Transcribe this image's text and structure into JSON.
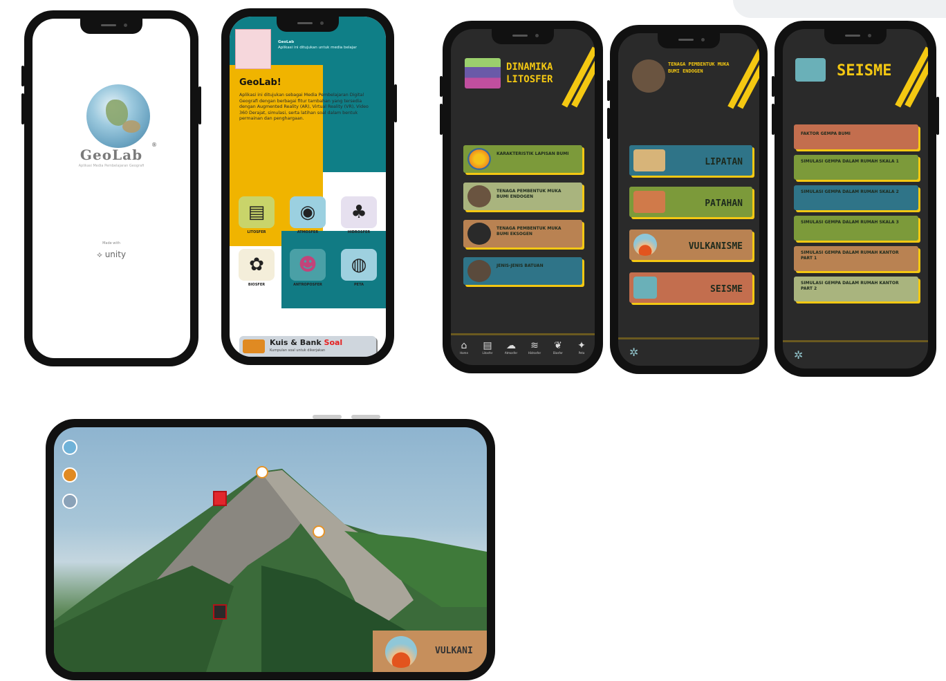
{
  "splash": {
    "brand": "GeoLab",
    "registered": "®",
    "tagline": "Aplikasi Media Pembelajaran Geografi",
    "made_with": "Made with",
    "engine": "unity"
  },
  "home": {
    "header_text": "GeoLab",
    "header_sub": "Aplikasi ini ditujukan untuk media belajar",
    "title": "GeoLab!",
    "description": "Aplikasi ini ditujukan sebagai Media Pembelajaran Digital Geografi dengan berbagai fitur tambahan yang tersedia dengan Augmented Reality (AR), Virtual Reality (VR), Video 360 Derajat, simulasi, serta latihan soal dalam bentuk permainan dan penghargaan.",
    "menu": [
      {
        "label": "LITOSFER",
        "icon": "layers-icon"
      },
      {
        "label": "ATMOSFER",
        "icon": "camera-icon"
      },
      {
        "label": "HIDROSFER",
        "icon": "tree-icon"
      },
      {
        "label": "BIOSFER",
        "icon": "flower-icon"
      },
      {
        "label": "ANTROPOSFER",
        "icon": "people-icon"
      },
      {
        "label": "PETA",
        "icon": "map-icon"
      }
    ],
    "quiz_title": "Kuis & Bank",
    "quiz_title_red": "Soal",
    "quiz_sub": "Kumpulan soal untuk dikerjakan"
  },
  "litosfer": {
    "title": "DINAMIKA LITOSFER",
    "items": [
      {
        "label": "KARAKTERISTIK LAPISAN BUMI",
        "color": "#7c9a3a"
      },
      {
        "label": "TENAGA PEMBENTUK MUKA BUMI ENDOGEN",
        "color": "#a9b47e"
      },
      {
        "label": "TENAGA PEMBENTUK MUKA BUMI EKSOGEN",
        "color": "#b98252"
      },
      {
        "label": "JENIS-JENIS BATUAN",
        "color": "#2f7488"
      }
    ],
    "nav": [
      "Home",
      "Litosfer",
      "Atmosfer",
      "Hidrosfer",
      "Biosfer",
      "Peta"
    ]
  },
  "endogen": {
    "title": "TENAGA PEMBENTUK MUKA BUMI ENDOGEN",
    "items": [
      {
        "label": "LIPATAN",
        "color": "#2f7488"
      },
      {
        "label": "PATAHAN",
        "color": "#7c9a3a"
      },
      {
        "label": "VULKANISME",
        "color": "#b98252"
      },
      {
        "label": "SEISME",
        "color": "#c36e4e"
      }
    ]
  },
  "seisme": {
    "title": "SEISME",
    "items": [
      {
        "label": "FAKTOR GEMPA BUMI",
        "color": "#c36e4e"
      },
      {
        "label": "SIMULASI GEMPA DALAM RUMAH SKALA 1",
        "color": "#7c9a3a"
      },
      {
        "label": "SIMULASI GEMPA DALAM RUMAH SKALA 2",
        "color": "#2f7488"
      },
      {
        "label": "SIMULASI GEMPA DALAM RUMAH SKALA 3",
        "color": "#7c9a3a"
      },
      {
        "label": "SIMULASI GEMPA DALAM RUMAH KANTOR PART 1",
        "color": "#b98252"
      },
      {
        "label": "SIMULASI GEMPA DALAM RUMAH KANTOR PART 2",
        "color": "#a9b47e"
      }
    ]
  },
  "vr_view": {
    "panel_label": "VULKANI"
  }
}
